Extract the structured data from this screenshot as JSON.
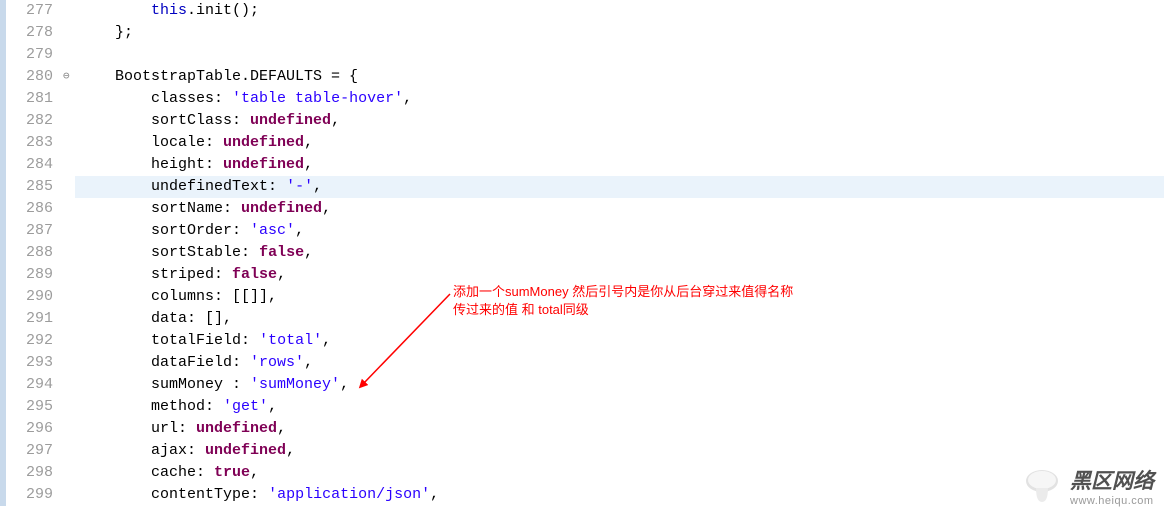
{
  "lines": [
    {
      "num": 277
    },
    {
      "num": 278
    },
    {
      "num": 279
    },
    {
      "num": 280,
      "fold": true
    },
    {
      "num": 281
    },
    {
      "num": 282
    },
    {
      "num": 283
    },
    {
      "num": 284
    },
    {
      "num": 285,
      "hl": true
    },
    {
      "num": 286
    },
    {
      "num": 287
    },
    {
      "num": 288
    },
    {
      "num": 289
    },
    {
      "num": 290
    },
    {
      "num": 291
    },
    {
      "num": 292
    },
    {
      "num": 293
    },
    {
      "num": 294
    },
    {
      "num": 295
    },
    {
      "num": 296
    },
    {
      "num": 297
    },
    {
      "num": 298
    },
    {
      "num": 299
    }
  ],
  "code": {
    "l277": {
      "kw": "this",
      "call": ".init();"
    },
    "l278": {
      "text": "};"
    },
    "l280": {
      "obj": "BootstrapTable.DEFAULTS = {"
    },
    "l281": {
      "key": "classes:",
      "val": "'table table-hover'"
    },
    "l282": {
      "key": "sortClass:",
      "val": "undefined"
    },
    "l283": {
      "key": "locale:",
      "val": "undefined"
    },
    "l284": {
      "key": "height:",
      "val": "undefined"
    },
    "l285": {
      "key": "undefinedText:",
      "val": "'-'"
    },
    "l286": {
      "key": "sortName:",
      "val": "undefined"
    },
    "l287": {
      "key": "sortOrder:",
      "val": "'asc'"
    },
    "l288": {
      "key": "sortStable:",
      "val": "false"
    },
    "l289": {
      "key": "striped:",
      "val": "false"
    },
    "l290": {
      "key": "columns:",
      "raw": "[[]],"
    },
    "l291": {
      "key": "data:",
      "raw": "[],"
    },
    "l292": {
      "key": "totalField:",
      "val": "'total'"
    },
    "l293": {
      "key": "dataField:",
      "val": "'rows'"
    },
    "l294": {
      "key": "sumMoney :",
      "val": "'sumMoney'"
    },
    "l295": {
      "key": "method:",
      "val": "'get'"
    },
    "l296": {
      "key": "url:",
      "val": "undefined"
    },
    "l297": {
      "key": "ajax:",
      "val": "undefined"
    },
    "l298": {
      "key": "cache:",
      "val": "true"
    },
    "l299": {
      "key": "contentType:",
      "val": "'application/json'"
    }
  },
  "annotation": {
    "line1": "添加一个sumMoney  然后引号内是你从后台穿过来值得名称",
    "line2": "传过来的值 和 total同级"
  },
  "watermark": {
    "main": "黑区网络",
    "sub": "www.heiqu.com"
  }
}
